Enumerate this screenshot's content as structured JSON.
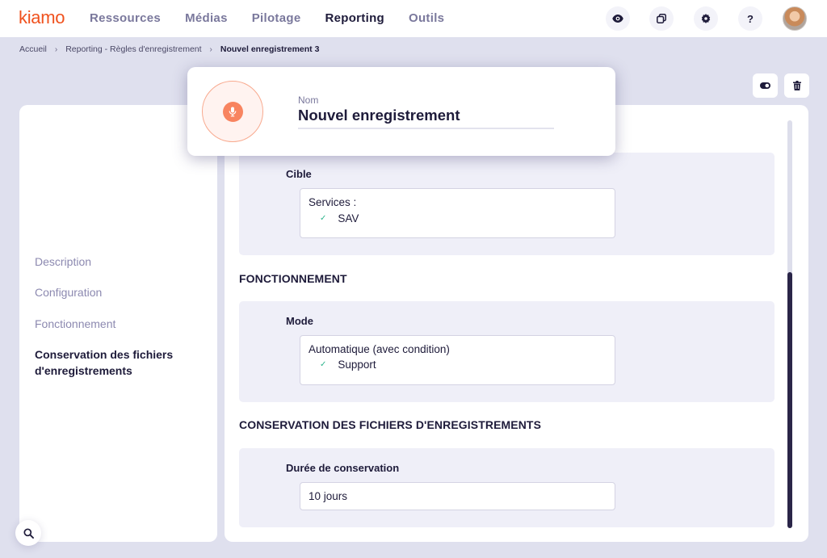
{
  "app": {
    "logo": "kiamo",
    "brand_color": "#f0521e"
  },
  "nav": {
    "items": [
      {
        "label": "Ressources",
        "active": false
      },
      {
        "label": "Médias",
        "active": false
      },
      {
        "label": "Pilotage",
        "active": false
      },
      {
        "label": "Reporting",
        "active": true
      },
      {
        "label": "Outils",
        "active": false
      }
    ],
    "icons": [
      "eye-icon",
      "windows-icon",
      "gear-icon",
      "help-icon"
    ],
    "help_label": "?"
  },
  "breadcrumb": {
    "items": [
      "Accueil",
      "Reporting - Règles d'enregistrement",
      "Nouvel enregistrement 3"
    ],
    "separator": "›"
  },
  "actions": {
    "toggle_icon": "toggle-icon",
    "delete_icon": "trash-icon"
  },
  "header_card": {
    "icon": "microphone-icon",
    "name_label": "Nom",
    "name_value": "Nouvel enregistrement"
  },
  "sidebar": {
    "items": [
      {
        "label": "Description",
        "active": false
      },
      {
        "label": "Configuration",
        "active": false
      },
      {
        "label": "Fonctionnement",
        "active": false
      },
      {
        "label": "Conservation des fichiers d'enregistrements",
        "active": true
      }
    ]
  },
  "main": {
    "cible": {
      "label": "Cible",
      "line1": "Services :",
      "line2": "SAV"
    },
    "fonctionnement": {
      "title": "FONCTIONNEMENT",
      "label": "Mode",
      "line1": "Automatique (avec condition)",
      "line2": "Support"
    },
    "conservation": {
      "title": "CONSERVATION DES FICHIERS D'ENREGISTREMENTS",
      "label": "Durée de conservation",
      "value": "10 jours"
    },
    "check_glyph": "✓"
  },
  "scrollbar": {
    "position_fraction": 0.37
  }
}
